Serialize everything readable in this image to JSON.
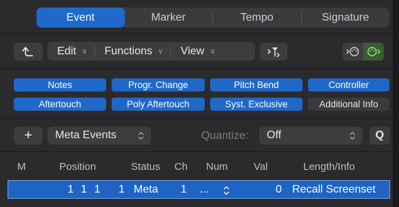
{
  "tabs": [
    {
      "label": "Event",
      "active": true
    },
    {
      "label": "Marker",
      "active": false
    },
    {
      "label": "Tempo",
      "active": false
    },
    {
      "label": "Signature",
      "active": false
    }
  ],
  "toolbar": {
    "back_icon": "arrow-up-left-icon",
    "edit_label": "Edit",
    "functions_label": "Functions",
    "view_label": "View",
    "midi_out_icon": "midi-out-icon",
    "midi_in_icon": "midi-in-icon"
  },
  "filters": {
    "row1": [
      "Notes",
      "Progr. Change",
      "Pitch Bend",
      "Controller"
    ],
    "row2": [
      "Aftertouch",
      "Poly Aftertouch",
      "Syst. Exclusive",
      "Additional Info"
    ]
  },
  "meta": {
    "add_label": "+",
    "type_label": "Meta Events",
    "quantize_label": "Quantize:",
    "quantize_value": "Off",
    "q_button": "Q"
  },
  "table": {
    "columns": [
      "M",
      "Position",
      "Status",
      "Ch",
      "Num",
      "Val",
      "Length/Info"
    ],
    "rows": [
      {
        "position": "1 1 1",
        "pos_tick": "1",
        "status": "Meta",
        "ch": "1",
        "num": "...",
        "val": "0",
        "info": "Recall Screenset"
      }
    ]
  },
  "colors": {
    "accent": "#1e69c9",
    "background": "#2b2b2e",
    "midi_active": "#3a5d33"
  }
}
